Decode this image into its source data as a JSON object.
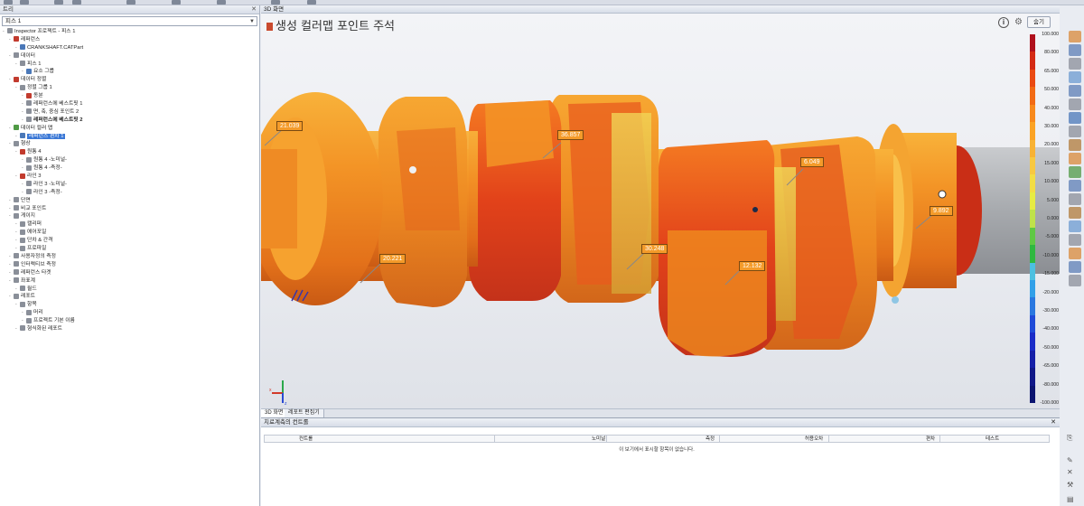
{
  "tree_panel": {
    "title": "트리",
    "piece_selector": "피스 1",
    "items": [
      {
        "label": "Inspector 프로젝트 - 피스 1",
        "depth": 0,
        "icon": "project-icon",
        "color": "gray"
      },
      {
        "label": "레퍼런스",
        "depth": 1,
        "icon": "reference-icon",
        "color": "red"
      },
      {
        "label": "CRANKSHAFT.CATPart",
        "depth": 2,
        "icon": "cad-part-icon",
        "color": "blue"
      },
      {
        "label": "데이터",
        "depth": 1,
        "icon": "data-icon",
        "color": "gray"
      },
      {
        "label": "피스 1",
        "depth": 2,
        "icon": "piece-icon",
        "color": "gray"
      },
      {
        "label": "요소 그룹",
        "depth": 3,
        "icon": "element-group-icon",
        "color": "blue"
      },
      {
        "label": "데이터 정렬",
        "depth": 1,
        "icon": "alignment-icon",
        "color": "red"
      },
      {
        "label": "정렬 그룹 1",
        "depth": 2,
        "icon": "align-group-icon",
        "color": "gray"
      },
      {
        "label": "동분",
        "depth": 3,
        "icon": "equal-icon",
        "color": "red"
      },
      {
        "label": "레퍼런스에 베스트핏 1",
        "depth": 3,
        "icon": "bestfit-icon",
        "color": "gray"
      },
      {
        "label": "면, 축, 중심 포인트 2",
        "depth": 3,
        "icon": "face-axis-icon",
        "color": "gray"
      },
      {
        "label": "레퍼런스에 베스트핏 2",
        "depth": 3,
        "icon": "bestfit-icon",
        "color": "gray",
        "bold": true
      },
      {
        "label": "데이터 컬러 맵",
        "depth": 1,
        "icon": "color-map-icon",
        "color": "green"
      },
      {
        "label": "레퍼런스 편차 1",
        "depth": 2,
        "icon": "deviation-icon",
        "color": "blue",
        "selected": true
      },
      {
        "label": "형상",
        "depth": 1,
        "icon": "shape-icon",
        "color": "gray"
      },
      {
        "label": "원통 4",
        "depth": 2,
        "icon": "cylinder-icon",
        "color": "red"
      },
      {
        "label": "원통 4 -노미널-",
        "depth": 3,
        "icon": "nominal-icon",
        "color": "gray"
      },
      {
        "label": "원통 4 -측정-",
        "depth": 3,
        "icon": "measured-icon",
        "color": "gray"
      },
      {
        "label": "라인 3",
        "depth": 2,
        "icon": "line-icon",
        "color": "red"
      },
      {
        "label": "라인 3 -노미널-",
        "depth": 3,
        "icon": "nominal-icon",
        "color": "gray"
      },
      {
        "label": "라인 3 -측정-",
        "depth": 3,
        "icon": "measured-icon",
        "color": "gray"
      },
      {
        "label": "단면",
        "depth": 1,
        "icon": "section-icon",
        "color": "gray"
      },
      {
        "label": "비교 포인트",
        "depth": 1,
        "icon": "compare-point-icon",
        "color": "gray"
      },
      {
        "label": "게이지",
        "depth": 1,
        "icon": "gauge-icon",
        "color": "gray"
      },
      {
        "label": "캘리퍼",
        "depth": 2,
        "icon": "caliper-icon",
        "color": "gray"
      },
      {
        "label": "에어포일",
        "depth": 2,
        "icon": "airfoil-icon",
        "color": "gray"
      },
      {
        "label": "단차 & 간격",
        "depth": 2,
        "icon": "gap-flush-icon",
        "color": "gray"
      },
      {
        "label": "프로파일",
        "depth": 2,
        "icon": "profile-icon",
        "color": "gray"
      },
      {
        "label": "사용자정의 측정",
        "depth": 1,
        "icon": "custom-measure-icon",
        "color": "gray"
      },
      {
        "label": "인터랙티브 측정",
        "depth": 1,
        "icon": "interactive-measure-icon",
        "color": "gray"
      },
      {
        "label": "레퍼런스 타겟",
        "depth": 1,
        "icon": "target-icon",
        "color": "gray"
      },
      {
        "label": "좌표계",
        "depth": 1,
        "icon": "coordinate-icon",
        "color": "gray"
      },
      {
        "label": "월드",
        "depth": 2,
        "icon": "world-icon",
        "color": "gray"
      },
      {
        "label": "레포트",
        "depth": 1,
        "icon": "report-icon",
        "color": "gray"
      },
      {
        "label": "항목",
        "depth": 2,
        "icon": "items-icon",
        "color": "gray"
      },
      {
        "label": "머리",
        "depth": 3,
        "icon": "header-icon",
        "color": "gray"
      },
      {
        "label": "프로젝트 기본 이름",
        "depth": 3,
        "icon": "name-icon",
        "color": "gray"
      },
      {
        "label": "형식화된 레포트",
        "depth": 2,
        "icon": "formatted-report-icon",
        "color": "gray"
      }
    ]
  },
  "view": {
    "title": "3D 화면",
    "heading": "생성 컬러맵 포인트 주석",
    "hide_label": "숨기",
    "callouts": [
      "21.039",
      "36.857",
      "6.049",
      "9.892",
      "20.221",
      "30.248",
      "12.132"
    ],
    "tabs": [
      "3D 화면",
      "레포트 편집기"
    ]
  },
  "color_scale": {
    "ticks": [
      "100.000",
      "80.000",
      "65.000",
      "50.000",
      "40.000",
      "30.000",
      "20.000",
      "15.000",
      "10.000",
      "5.000",
      "0.000",
      "-5.000",
      "-10.000",
      "-15.000",
      "-20.000",
      "-30.000",
      "-40.000",
      "-50.000",
      "-65.000",
      "-80.000",
      "-100.000"
    ],
    "colors": [
      "#b0101c",
      "#d42a14",
      "#ea4a12",
      "#f26a14",
      "#f8891c",
      "#fba324",
      "#f8b234",
      "#f8c840",
      "#f3dd44",
      "#e7ec43",
      "#bfe24a",
      "#5fc844",
      "#2fb840",
      "#4cc0e0",
      "#32a0e8",
      "#2a78e0",
      "#1f4bd8",
      "#1a2cc8",
      "#151fa8",
      "#101888",
      "#0b1470"
    ]
  },
  "bottom_panel": {
    "title": "치료계측의 컨트롤",
    "columns": [
      "컨트롤",
      "노미널",
      "측정",
      "허용오차",
      "편차",
      "테스트"
    ],
    "empty_message": "이 보기에서 표시할 항목이 없습니다."
  }
}
